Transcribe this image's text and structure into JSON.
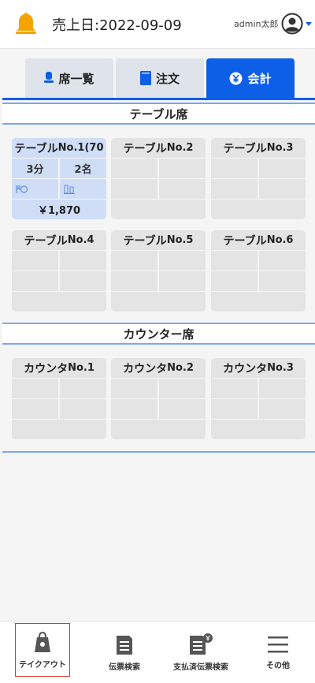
{
  "header": {
    "sales_date_label": "売上日:2022-09-09",
    "user_name": "admin太郎",
    "accent_color": "#0d5fe8",
    "bell_color": "#f5a300"
  },
  "tabs": [
    {
      "label": "席一覧",
      "icon": "seat-icon",
      "active": false
    },
    {
      "label": "注文",
      "icon": "order-book-icon",
      "active": false
    },
    {
      "label": "会計",
      "icon": "yen-circle-icon",
      "active": true
    }
  ],
  "sections": {
    "table_seats": "テーブル席",
    "counter_seats": "カウンター席"
  },
  "table_cards": [
    {
      "name": "テーブル",
      "no": "No.1(70",
      "active": true,
      "minutes": "3分",
      "people": "2名",
      "amount": "￥1,870"
    },
    {
      "name": "テーブル",
      "no": "No.2",
      "active": false
    },
    {
      "name": "テーブル",
      "no": "No.3",
      "active": false
    },
    {
      "name": "テーブル",
      "no": "No.4",
      "active": false
    },
    {
      "name": "テーブル",
      "no": "No.5",
      "active": false
    },
    {
      "name": "テーブル",
      "no": "No.6",
      "active": false
    }
  ],
  "counter_cards": [
    {
      "name": "カウンタ",
      "no": "No.1"
    },
    {
      "name": "カウンタ",
      "no": "No.2"
    },
    {
      "name": "カウンタ",
      "no": "No.3"
    }
  ],
  "bottom_nav": [
    {
      "label": "テイクアウト",
      "icon": "takeout-bag-icon"
    },
    {
      "label": "伝票検索",
      "icon": "slip-search-icon"
    },
    {
      "label": "支払済伝票検索",
      "icon": "paid-slip-search-icon"
    },
    {
      "label": "その他",
      "icon": "menu-icon"
    }
  ]
}
